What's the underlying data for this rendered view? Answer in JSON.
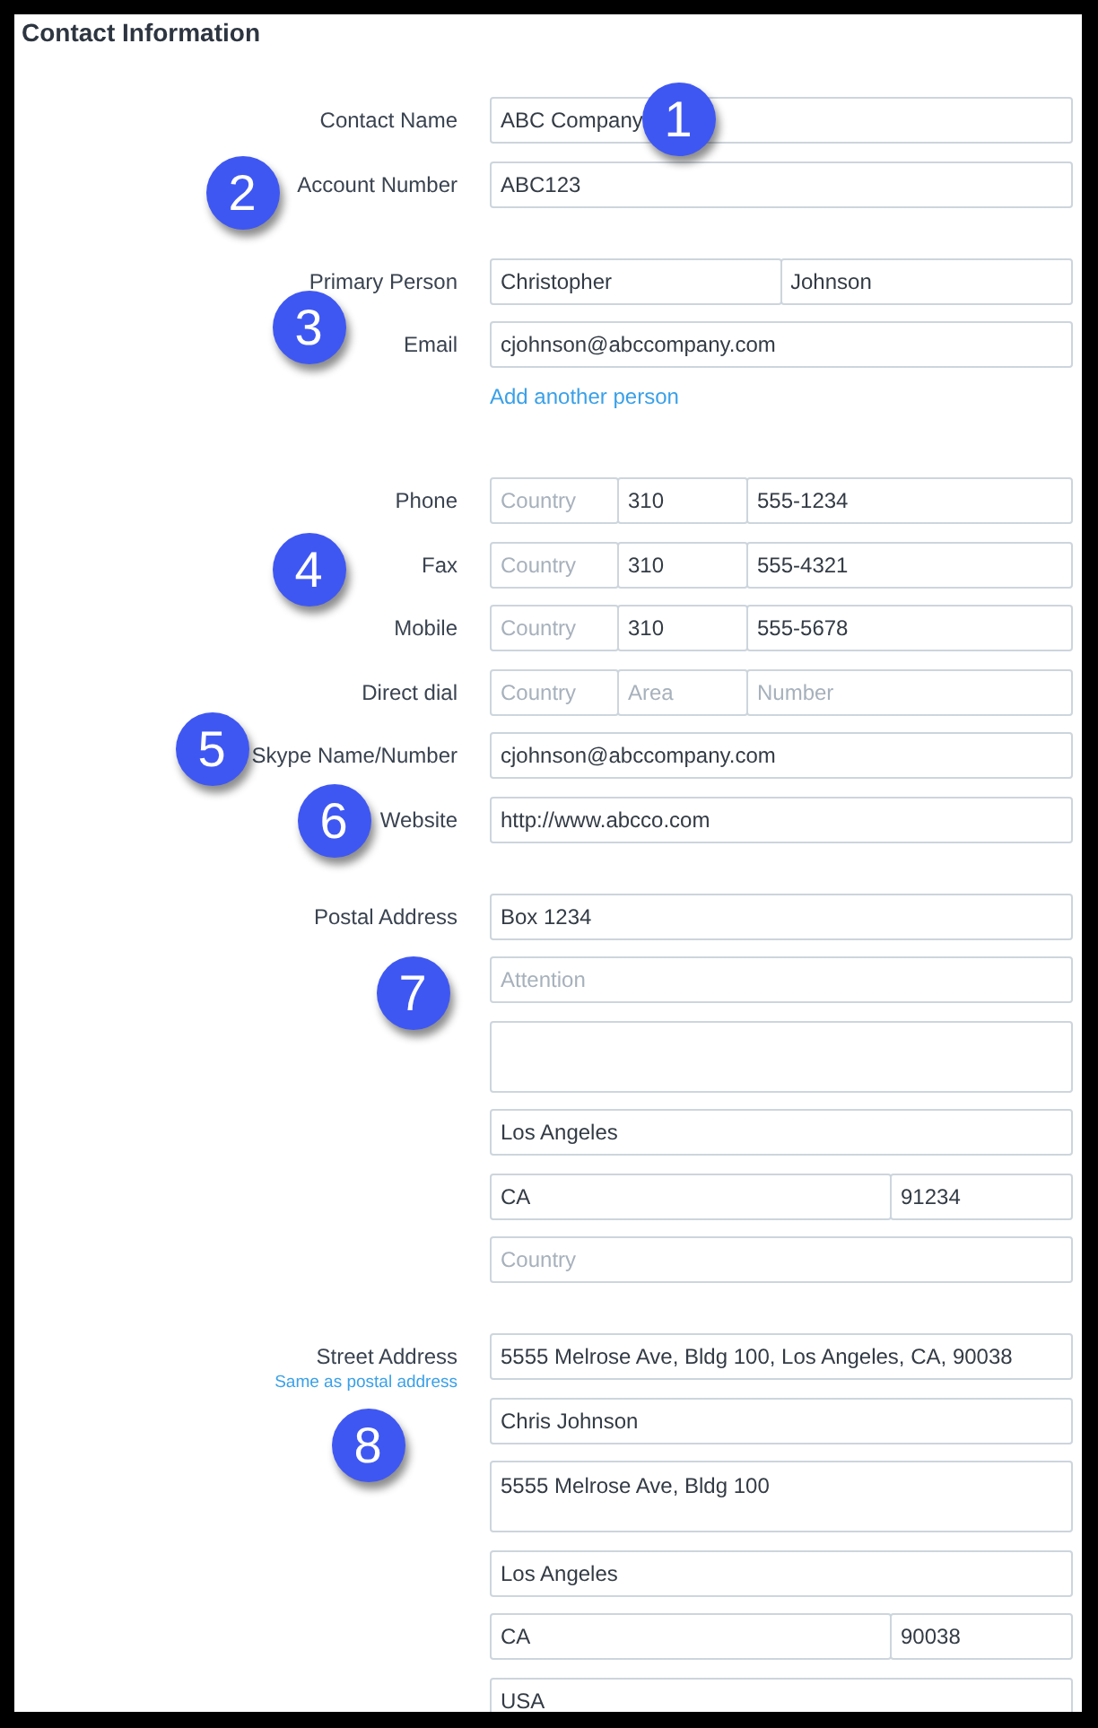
{
  "title": "Contact Information",
  "sections": [
    {
      "rows": [
        {
          "kind": "single",
          "label": "Contact Name",
          "fields": [
            {
              "value": "ABC Company"
            }
          ]
        },
        {
          "kind": "single",
          "label": "Account Number",
          "fields": [
            {
              "value": "ABC123"
            }
          ]
        }
      ]
    },
    {
      "rows": [
        {
          "kind": "name",
          "label": "Primary Person",
          "fields": [
            {
              "value": "Christopher"
            },
            {
              "value": "Johnson"
            }
          ]
        },
        {
          "kind": "single",
          "label": "Email",
          "fields": [
            {
              "value": "cjohnson@abccompany.com"
            }
          ]
        }
      ],
      "link": "Add another person"
    },
    {
      "rows": [
        {
          "kind": "phone",
          "label": "Phone",
          "fields": [
            {
              "placeholder": "Country"
            },
            {
              "value": "310"
            },
            {
              "value": "555-1234"
            }
          ]
        },
        {
          "kind": "phone",
          "label": "Fax",
          "fields": [
            {
              "placeholder": "Country"
            },
            {
              "value": "310"
            },
            {
              "value": "555-4321"
            }
          ]
        },
        {
          "kind": "phone",
          "label": "Mobile",
          "fields": [
            {
              "placeholder": "Country"
            },
            {
              "value": "310"
            },
            {
              "value": "555-5678"
            }
          ]
        },
        {
          "kind": "phone",
          "label": "Direct dial",
          "fields": [
            {
              "placeholder": "Country"
            },
            {
              "placeholder": "Area"
            },
            {
              "placeholder": "Number"
            }
          ]
        },
        {
          "kind": "single",
          "label": "Skype Name/Number",
          "fields": [
            {
              "value": "cjohnson@abccompany.com"
            }
          ]
        },
        {
          "kind": "single",
          "label": "Website",
          "fields": [
            {
              "value": "http://www.abcco.com"
            }
          ]
        }
      ]
    },
    {
      "rows": [
        {
          "kind": "single",
          "label": "Postal Address",
          "fields": [
            {
              "value": "Box 1234"
            }
          ]
        },
        {
          "kind": "single",
          "fields": [
            {
              "placeholder": "Attention"
            }
          ]
        },
        {
          "kind": "textarea"
        },
        {
          "kind": "single",
          "fields": [
            {
              "value": "Los Angeles"
            }
          ]
        },
        {
          "kind": "state_zip",
          "fields": [
            {
              "value": "CA"
            },
            {
              "value": "91234"
            }
          ]
        },
        {
          "kind": "single",
          "fields": [
            {
              "placeholder": "Country"
            }
          ]
        }
      ]
    },
    {
      "rows": [
        {
          "kind": "single",
          "label": "Street Address",
          "sublink": "Same as postal address",
          "fields": [
            {
              "value": "5555 Melrose Ave, Bldg 100, Los Angeles, CA, 90038"
            }
          ]
        },
        {
          "kind": "single",
          "fields": [
            {
              "value": "Chris Johnson"
            }
          ]
        },
        {
          "kind": "textarea",
          "value": "5555 Melrose Ave, Bldg 100"
        },
        {
          "kind": "single",
          "fields": [
            {
              "value": "Los Angeles"
            }
          ]
        },
        {
          "kind": "state_zip",
          "fields": [
            {
              "value": "CA"
            },
            {
              "value": "90038"
            }
          ]
        },
        {
          "kind": "single",
          "fields": [
            {
              "value": "USA"
            }
          ]
        }
      ]
    }
  ],
  "callouts": [
    "1",
    "2",
    "3",
    "4",
    "5",
    "6",
    "7",
    "8"
  ]
}
